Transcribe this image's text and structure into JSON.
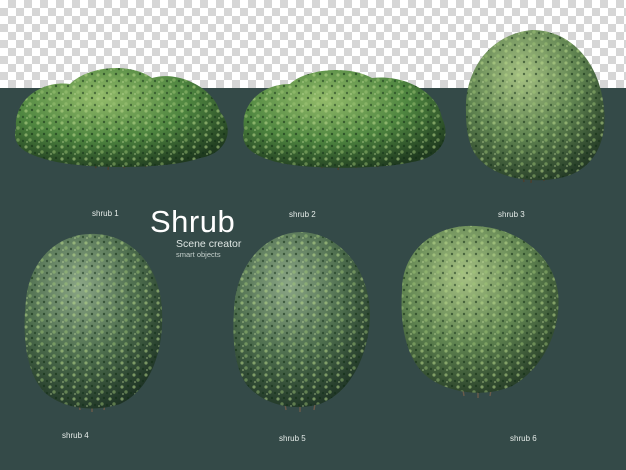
{
  "title": "Shrub",
  "subtitle": "Scene creator",
  "tagline": "smart objects",
  "labels": [
    "shrub 1",
    "shrub 2",
    "shrub 3",
    "shrub 4",
    "shrub 5",
    "shrub 6"
  ],
  "colors": {
    "background": "#344a48",
    "checker_light": "#ffffff",
    "checker_dark": "#d6d6d6",
    "foliage_light": "#93bb6a",
    "foliage_dark": "#1f3a1f"
  }
}
